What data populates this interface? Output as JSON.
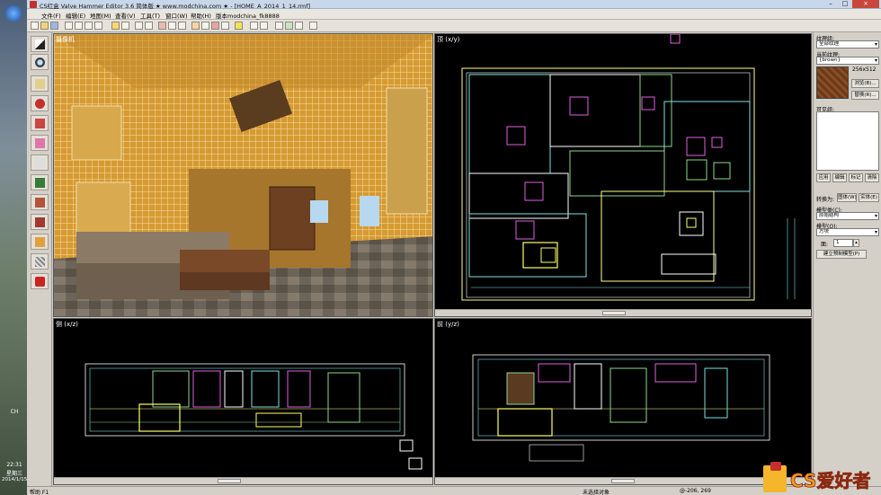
{
  "window": {
    "title": "CS红盒 Valve Hammer Editor 3.6 简体版 ★ www.modchina.com ★ - [HOME_A_2014_1_14.rmf]"
  },
  "menu": {
    "items": [
      "文件(F)",
      "编辑(E)",
      "地图(M)",
      "查看(V)",
      "工具(T)",
      "窗口(W)",
      "帮助(H)",
      "版本modchina_fk8888"
    ]
  },
  "viewports": {
    "camera": {
      "label": "摄像机"
    },
    "top": {
      "label": "顶 (x/y)"
    },
    "side": {
      "label": "侧 (x/z)"
    },
    "front": {
      "label": "前 (y/z)"
    }
  },
  "panel": {
    "texture_group_label": "纹理组:",
    "texture_group_value": "全部纹理",
    "current_texture_label": "当前纹理:",
    "current_texture_value": "{brown}",
    "texture_size": "256x512",
    "browse_button": "浏览(B)...",
    "replace_button": "替换(R)...",
    "visgroup_label": "可见组:",
    "apply_button": "应用",
    "edit_button": "编辑",
    "mark_button": "标记",
    "purge_button": "清除",
    "convert_label": "转换为:",
    "convert_world": "图体(W)",
    "convert_entity": "实体(E)",
    "category_label": "模型类(C):",
    "category_value": "原始结构",
    "object_label": "模型(O):",
    "object_value": "方块",
    "faces_label": "面:",
    "faces_value": "1",
    "create_prefab_button": "建立预制模型(P)"
  },
  "status": {
    "help": "帮助 F1",
    "selection": "未选择对象",
    "coords": "@-206, 269"
  },
  "desktop": {
    "lang": "CH",
    "time": "22:31",
    "weekday": "星期三",
    "date": "2014/1/15"
  },
  "brand": {
    "text": "CS爱好者"
  },
  "colors": {
    "accent": "#c4302b",
    "wire_yellow": "#ffff66",
    "wire_cyan": "#7fe0e0",
    "wire_green": "#8fd68f",
    "wire_magenta": "#e060e0",
    "wire_white": "#ffffff"
  }
}
